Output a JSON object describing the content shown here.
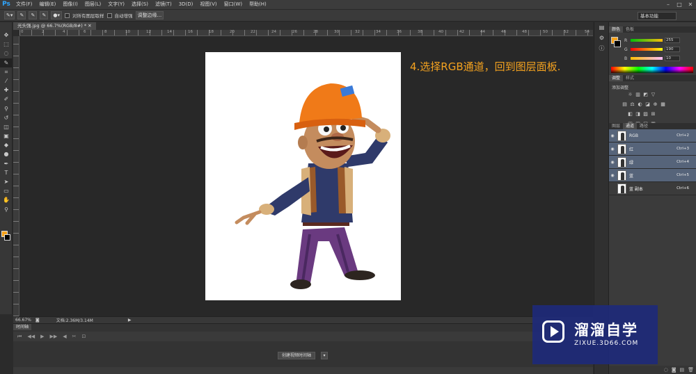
{
  "app": {
    "logo": "Ps"
  },
  "menubar": {
    "items": [
      "文件(F)",
      "编辑(E)",
      "图像(I)",
      "图层(L)",
      "文字(Y)",
      "选择(S)",
      "滤镜(T)",
      "3D(D)",
      "视图(V)",
      "窗口(W)",
      "帮助(H)"
    ],
    "window_controls": [
      "–",
      "□",
      "✕"
    ]
  },
  "options_bar": {
    "sample_all_layers_label": "对所有图层取样",
    "auto_enhance_label": "自动增强",
    "refine_edge_label": "调整边缘...",
    "workspace": "基本功能"
  },
  "tools": {
    "icons": [
      "move-icon",
      "marquee-icon",
      "lasso-icon",
      "quick-select-icon",
      "crop-icon",
      "eyedropper-icon",
      "healing-icon",
      "brush-icon",
      "stamp-icon",
      "history-brush-icon",
      "eraser-icon",
      "gradient-icon",
      "blur-icon",
      "dodge-icon",
      "pen-icon",
      "type-icon",
      "path-select-icon",
      "shape-icon",
      "hand-icon",
      "zoom-icon"
    ],
    "glyphs": [
      "✥",
      "⬚",
      "◌",
      "✎",
      "⌗",
      "⁄",
      "✚",
      "✐",
      "⚲",
      "↺",
      "◫",
      "▣",
      "◆",
      "●",
      "✒",
      "T",
      "➤",
      "▭",
      "✋",
      "⚲"
    ],
    "foreground_color": "#f6a21a",
    "background_color": "#000000"
  },
  "document": {
    "tab_title": "光头强.jpg @ 66.7%(RGB/8#) *",
    "ruler_numbers": [
      "0",
      "2",
      "4",
      "6",
      "8",
      "10",
      "12",
      "14",
      "16",
      "18",
      "20",
      "22",
      "24",
      "26",
      "28",
      "30",
      "32",
      "34",
      "36",
      "38",
      "40",
      "42",
      "44",
      "46",
      "48",
      "50",
      "52",
      "54"
    ]
  },
  "annotation": {
    "text": "4.选择RGB通道，回到图层面板."
  },
  "status_bar": {
    "zoom": "66.67%",
    "doc_info": "文档:2.36M/3.14M"
  },
  "timeline": {
    "tab_label": "时间轴",
    "create_video_label": "创建视频时间轴",
    "dropdown_glyph": "▾",
    "ctrl_glyphs": [
      "⏮",
      "◀◀",
      "▶",
      "▶▶",
      "◀",
      "✂",
      "⊡"
    ]
  },
  "color_panel": {
    "tabs": [
      "颜色",
      "色板"
    ],
    "r_label": "R",
    "r_value": "255",
    "g_label": "G",
    "g_value": "190",
    "b_label": "B",
    "b_value": "10"
  },
  "adjustments_panel": {
    "tabs": [
      "调整",
      "样式"
    ],
    "title": "添加调整",
    "row1": [
      "☼",
      "▥",
      "◩",
      "▽"
    ],
    "row2": [
      "▤",
      "⚖",
      "◐",
      "◪",
      "⊕",
      "▦"
    ],
    "row3": [
      "◧",
      "◨",
      "▨",
      "⊞"
    ],
    "row4": [
      "◫",
      "◰",
      "◱",
      "▣"
    ]
  },
  "channels_panel": {
    "tabs": [
      "图层",
      "通道",
      "路径"
    ],
    "channels": [
      {
        "name": "RGB",
        "shortcut": "Ctrl+2"
      },
      {
        "name": "红",
        "shortcut": "Ctrl+3"
      },
      {
        "name": "绿",
        "shortcut": "Ctrl+4"
      },
      {
        "name": "蓝",
        "shortcut": "Ctrl+5"
      },
      {
        "name": "蓝 副本",
        "shortcut": "Ctrl+6"
      }
    ],
    "footer_glyphs": [
      "◌",
      "◙",
      "▤",
      "🗑"
    ]
  },
  "watermark": {
    "name": "溜溜自学",
    "url": "ZIXUE.3D66.COM"
  }
}
